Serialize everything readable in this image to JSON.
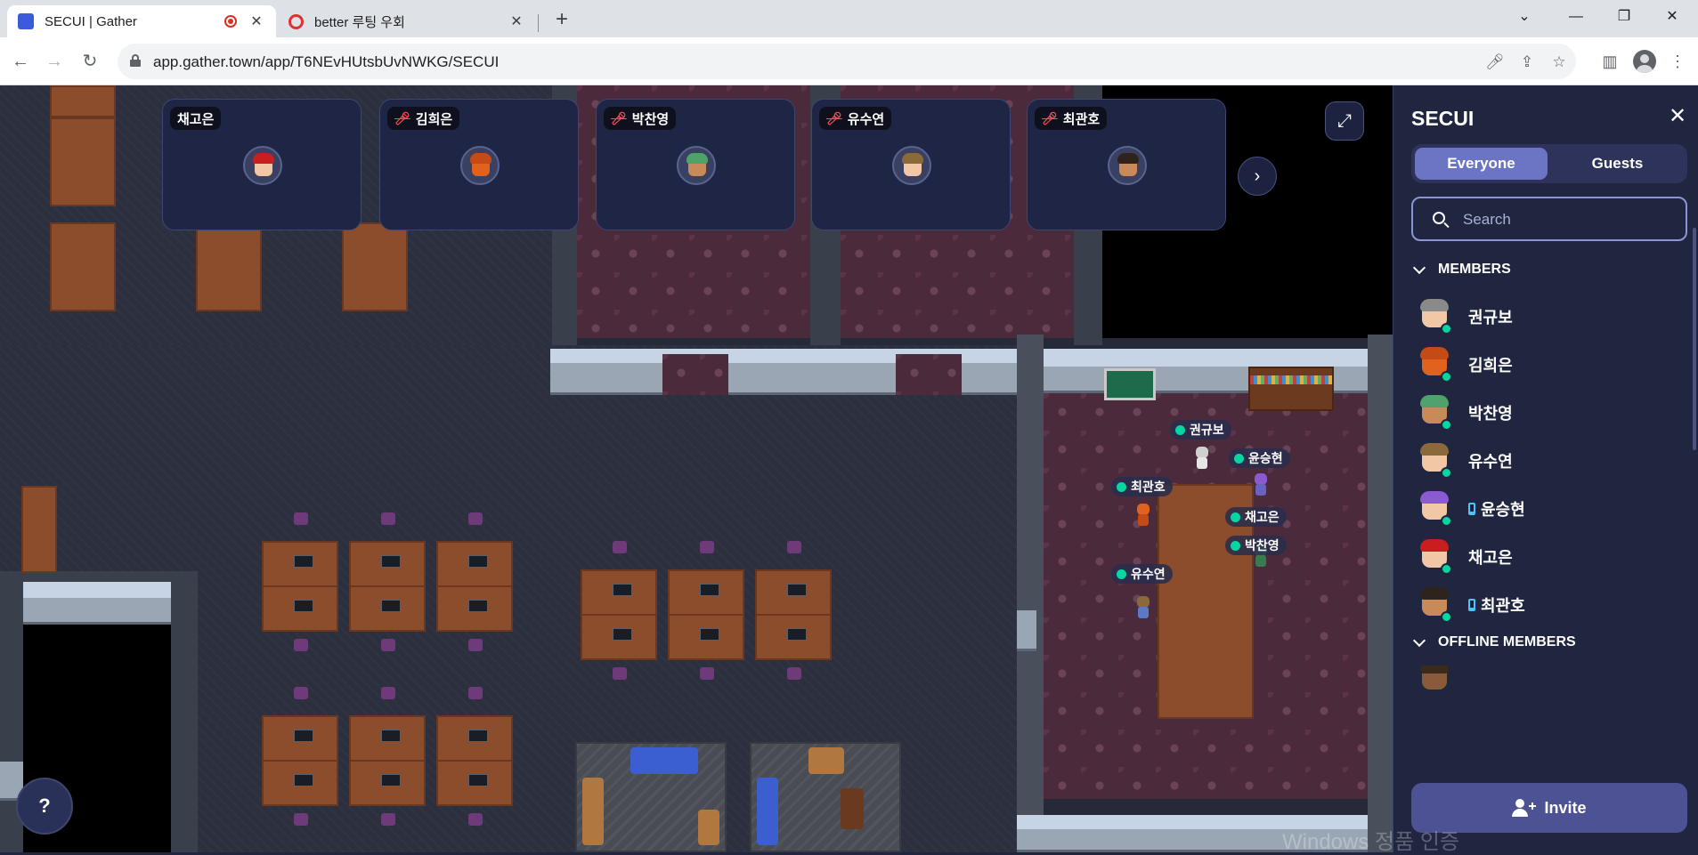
{
  "browser": {
    "tabs": [
      {
        "title": "SECUI | Gather",
        "active": true,
        "favicon_color": "#3b5bdb"
      },
      {
        "title": "better 루팅 우회",
        "active": false,
        "favicon_color": "#e03131"
      }
    ],
    "url": "app.gather.town/app/T6NEvHUtsbUvNWKG/SECUI",
    "window_controls": [
      "chevron-down",
      "minimize",
      "restore",
      "close"
    ]
  },
  "video_tiles": [
    {
      "name": "채고은",
      "muted": false,
      "hair_color": "#c81e1e",
      "skin_color": "#f2c7a5"
    },
    {
      "name": "김희은",
      "muted": true,
      "hair_color": "#e0621c",
      "skin_color": "#e0621c"
    },
    {
      "name": "박찬영",
      "muted": true,
      "hair_color": "#4fa36a",
      "skin_color": "#c98a5a"
    },
    {
      "name": "유수연",
      "muted": true,
      "hair_color": "#8a6a3a",
      "skin_color": "#f2c7a5"
    },
    {
      "name": "최관호",
      "muted": true,
      "hair_color": "#2e241c",
      "skin_color": "#c98a5a"
    }
  ],
  "map_players": [
    {
      "name": "권규보",
      "dot_color": "#06d6a0"
    },
    {
      "name": "윤승현",
      "dot_color": "#06d6a0"
    },
    {
      "name": "최관호",
      "dot_color": "#06d6a0"
    },
    {
      "name": "채고은",
      "dot_color": "#06d6a0"
    },
    {
      "name": "박찬영",
      "dot_color": "#06d6a0"
    },
    {
      "name": "유수연",
      "dot_color": "#06d6a0"
    }
  ],
  "help_button": "?",
  "sidebar": {
    "title": "SECUI",
    "tabs": [
      "Everyone",
      "Guests"
    ],
    "selected_tab": "Everyone",
    "search_placeholder": "Search",
    "members_heading": "MEMBERS",
    "offline_heading": "OFFLINE MEMBERS",
    "members": [
      {
        "name": "권규보",
        "mobile": false,
        "hair": "#8a8a8a",
        "skin": "#f2c7a5",
        "online": true
      },
      {
        "name": "김희은",
        "mobile": false,
        "hair": "#e0621c",
        "skin": "#e0621c",
        "online": true
      },
      {
        "name": "박찬영",
        "mobile": false,
        "hair": "#4fa36a",
        "skin": "#c98a5a",
        "online": true
      },
      {
        "name": "유수연",
        "mobile": false,
        "hair": "#8a6a3a",
        "skin": "#f2c7a5",
        "online": true
      },
      {
        "name": "윤승현",
        "mobile": true,
        "hair": "#8a5ad0",
        "skin": "#f2c7a5",
        "online": true
      },
      {
        "name": "채고은",
        "mobile": false,
        "hair": "#c81e1e",
        "skin": "#f2c7a5",
        "online": true
      },
      {
        "name": "최관호",
        "mobile": true,
        "hair": "#2e241c",
        "skin": "#c98a5a",
        "online": true
      }
    ],
    "invite_label": "Invite"
  },
  "watermark": "Windows 정품 인증",
  "colors": {
    "sidebar_bg": "#202540",
    "accent": "#6c75c4",
    "online": "#06d6a0",
    "muted": "#ff4a5c"
  }
}
